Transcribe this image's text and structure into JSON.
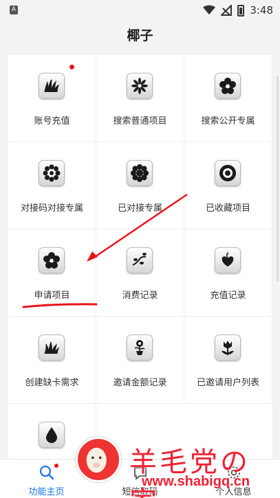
{
  "status_bar": {
    "time": "3:48",
    "left_icon_glyph": "A",
    "icons": [
      "wifi-icon",
      "cell-signal-off-icon",
      "battery-charging-icon"
    ]
  },
  "app_bar": {
    "title": "椰子"
  },
  "grid": {
    "items": [
      {
        "label": "账号充值",
        "icon": "grass-icon",
        "badge": true
      },
      {
        "label": "搜索普通项目",
        "icon": "star-flower-icon",
        "badge": false
      },
      {
        "label": "搜索公开专属",
        "icon": "five-petal-flower-icon",
        "badge": false
      },
      {
        "label": "对接码对接专属",
        "icon": "daisy-icon",
        "badge": false
      },
      {
        "label": "已对接专属",
        "icon": "sunflower-icon",
        "badge": false
      },
      {
        "label": "已收藏项目",
        "icon": "sun-ring-icon",
        "badge": false
      },
      {
        "label": "申请项目",
        "icon": "clover-flower-icon",
        "badge": false
      },
      {
        "label": "消费记录",
        "icon": "vine-icon",
        "badge": false
      },
      {
        "label": "充值记录",
        "icon": "leaf-heart-icon",
        "badge": false
      },
      {
        "label": "创建缺卡需求",
        "icon": "grass-tuft-icon",
        "badge": false
      },
      {
        "label": "邀请金额记录",
        "icon": "flower-pot-icon",
        "badge": false
      },
      {
        "label": "已邀请用户列表",
        "icon": "tulip-icon",
        "badge": false
      },
      {
        "label": "",
        "icon": "water-drop-icon",
        "badge": false
      }
    ]
  },
  "bottom_nav": {
    "tabs": [
      {
        "label": "功能主页",
        "icon": "search-icon",
        "active": true,
        "badge": true
      },
      {
        "label": "短信取码",
        "icon": "sms-icon",
        "active": false,
        "badge": false
      },
      {
        "label": "个人信息",
        "icon": "gear-icon",
        "active": false,
        "badge": false
      }
    ]
  },
  "watermark": {
    "title": "羊毛党の家",
    "url": "www.shabigq.cn"
  },
  "colors": {
    "accent": "#1a73e8",
    "badge_red": "#e8141c",
    "annotation_red": "#e8141c",
    "background": "#f3f3f3"
  }
}
